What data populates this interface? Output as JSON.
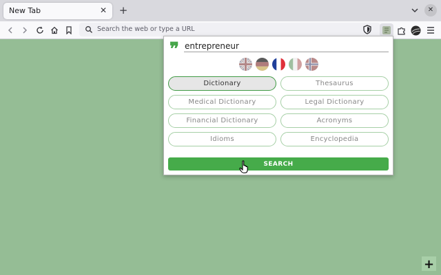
{
  "browser": {
    "tab": {
      "title": "New Tab"
    },
    "urlbar": {
      "placeholder": "Search the web or type a URL"
    }
  },
  "icons": {
    "back": "chevron-left-icon",
    "forward": "chevron-right-icon",
    "reload": "reload-icon",
    "home": "home-icon",
    "bookmark": "bookmark-icon",
    "shield": "shield-icon",
    "extensions": "puzzle-icon",
    "menu": "hamburger-icon"
  },
  "popup": {
    "query": "entrepreneur",
    "languages": [
      "English",
      "German",
      "French",
      "Italian",
      "Norwegian"
    ],
    "selected_option": "Dictionary",
    "options": [
      "Dictionary",
      "Thesaurus",
      "Medical Dictionary",
      "Legal Dictionary",
      "Financial Dictionary",
      "Acronyms",
      "Idioms",
      "Encyclopedia"
    ],
    "search_label": "SEARCH"
  },
  "page": {
    "add_label": "+"
  },
  "colors": {
    "background": "#95bd95",
    "accent": "#46ab4a",
    "button_border": "#a5cfa5"
  }
}
